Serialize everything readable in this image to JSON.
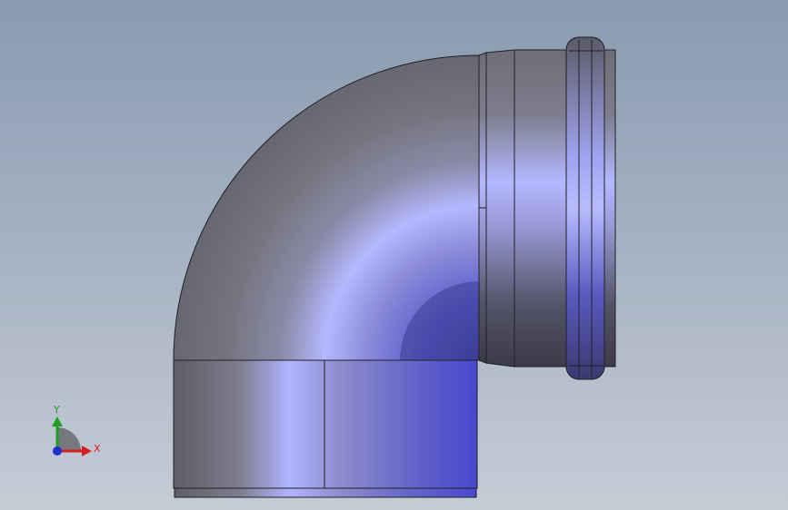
{
  "viewport": {
    "background_top": "#8a9bb0",
    "background_bottom": "#c6ccd6"
  },
  "model": {
    "type": "pipe-elbow-90",
    "body_colors": [
      "#5f6066",
      "#8a8aa0",
      "#b0b4ff",
      "#5a5ad0"
    ]
  },
  "triad": {
    "x_label": "X",
    "y_label": "Y",
    "x_color": "#d42020",
    "y_color": "#20a020",
    "z_color": "#2030d0"
  }
}
